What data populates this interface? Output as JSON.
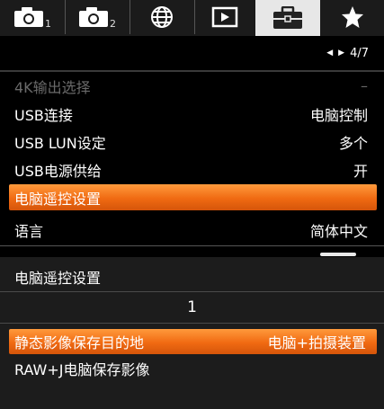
{
  "tabs": [
    {
      "icon": "camera-icon",
      "sub": "1",
      "active": false
    },
    {
      "icon": "camera-icon",
      "sub": "2",
      "active": false
    },
    {
      "icon": "globe-icon",
      "sub": "",
      "active": false
    },
    {
      "icon": "playback-icon",
      "sub": "",
      "active": false
    },
    {
      "icon": "toolbox-icon",
      "sub": "",
      "active": true
    },
    {
      "icon": "star-icon",
      "sub": "",
      "active": false
    }
  ],
  "pager": {
    "text": "4/7"
  },
  "menu": [
    {
      "label": "4K输出选择",
      "value": "–",
      "state": "disabled"
    },
    {
      "label": "USB连接",
      "value": "电脑控制",
      "state": "normal"
    },
    {
      "label": "USB LUN设定",
      "value": "多个",
      "state": "normal"
    },
    {
      "label": "USB电源供给",
      "value": "开",
      "state": "normal"
    },
    {
      "label": "电脑遥控设置",
      "value": "",
      "state": "selected"
    },
    {
      "label": "语言",
      "value": "简体中文",
      "state": "normal"
    }
  ],
  "submenu": {
    "title": "电脑遥控设置",
    "counter": "1",
    "items": [
      {
        "label": "静态影像保存目的地",
        "value": "电脑+拍摄装置",
        "state": "selected"
      },
      {
        "label": "RAW+J电脑保存影像",
        "value": "",
        "state": "normal"
      }
    ]
  },
  "colors": {
    "highlight": "#f06a12",
    "background": "#000000",
    "panel": "#1c1c1c",
    "active_tab": "#e7e7e7"
  }
}
